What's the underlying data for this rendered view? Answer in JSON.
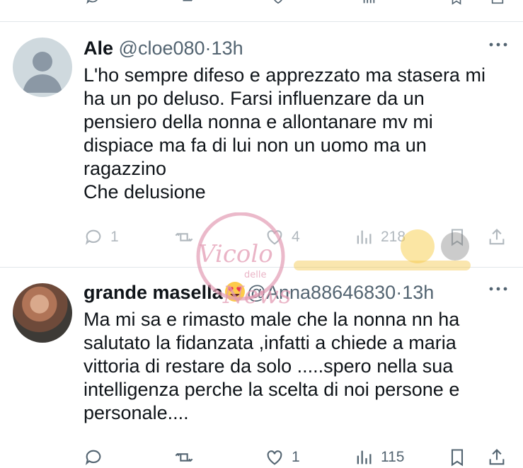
{
  "tweets": [
    {
      "name": "Ale",
      "handle": "@cloe080",
      "separator": "·",
      "time": "13h",
      "text": "L'ho sempre difeso e apprezzato ma stasera mi\nha un po deluso.  Farsi influenzare da un\npensiero della nonna e allontanare mv mi\ndispiace ma fa di lui non un uomo ma un\nragazzino\nChe delusione",
      "replies": "1",
      "retweets": "",
      "likes": "4",
      "views": "218"
    },
    {
      "name": "grande masella",
      "handle": "@Anna88646830",
      "separator": "·",
      "time": "13h",
      "text": "Ma mi sa e rimasto male che la nonna nn ha\nsalutato la fidanzata ,infatti a chiede  a maria\nvittoria di restare da solo .....spero nella sua\nintelligenza perche la scelta di noi persone e\npersonale....",
      "replies": "",
      "retweets": "",
      "likes": "1",
      "views": "115"
    }
  ],
  "watermark": {
    "line1": "Vicolo",
    "line2": "delle",
    "line3": "News"
  },
  "colors": {
    "text": "#0f1419",
    "secondary": "#536471",
    "divider": "#e1e6ea",
    "watermark": "#e39bb4"
  }
}
